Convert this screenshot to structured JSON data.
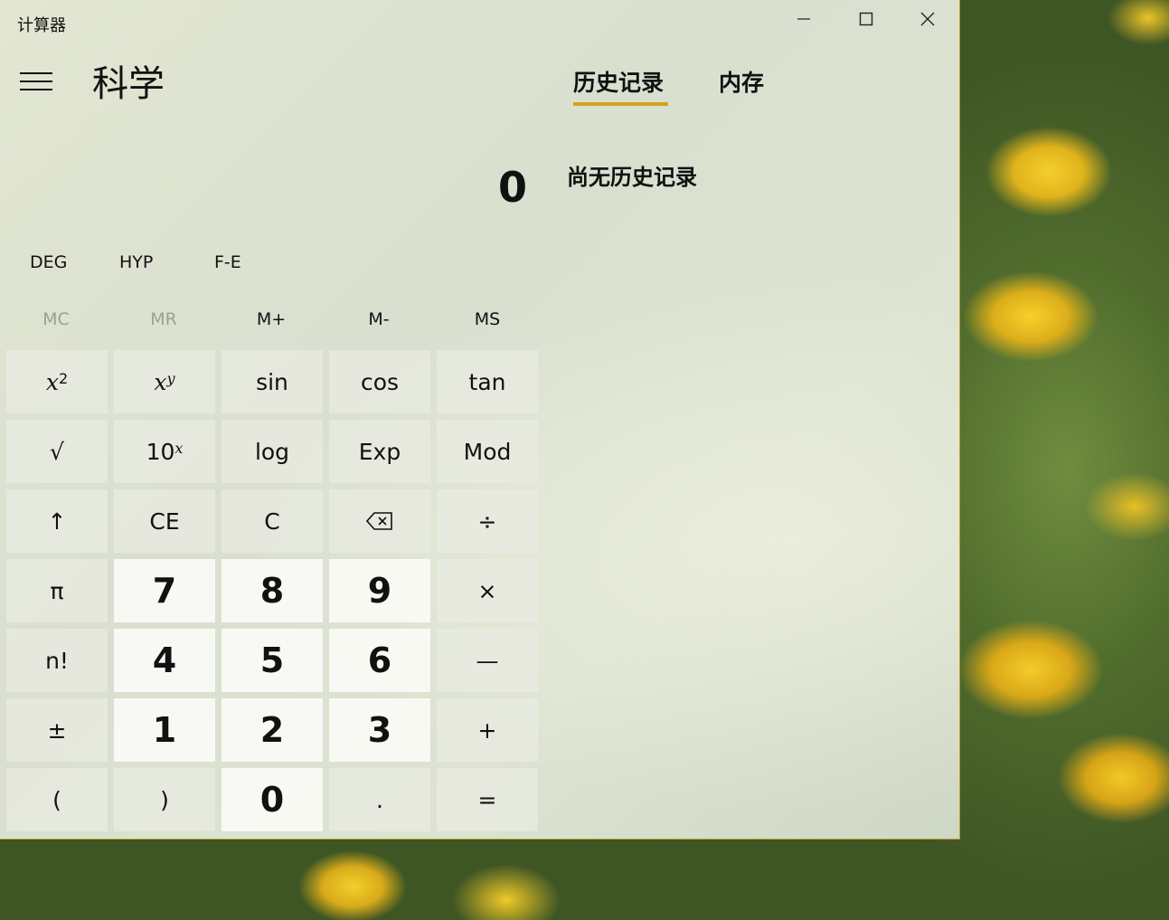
{
  "window": {
    "app_title": "计算器",
    "mode_title": "科学"
  },
  "tabs": {
    "history": "历史记录",
    "memory": "内存",
    "active": "history"
  },
  "history": {
    "empty_text": "尚无历史记录"
  },
  "display": {
    "value": "0"
  },
  "modes": {
    "angle": "DEG",
    "hyp": "HYP",
    "fe": "F-E"
  },
  "memory_buttons": [
    {
      "label": "MC",
      "enabled": false
    },
    {
      "label": "MR",
      "enabled": false
    },
    {
      "label": "M+",
      "enabled": true
    },
    {
      "label": "M-",
      "enabled": true
    },
    {
      "label": "MS",
      "enabled": true
    }
  ],
  "keys": {
    "x2_base": "x",
    "x2_exp": "2",
    "xy_base": "x",
    "xy_exp": "y",
    "sin": "sin",
    "cos": "cos",
    "tan": "tan",
    "sqrt": "√",
    "tenx_base": "10",
    "tenx_exp": "x",
    "log": "log",
    "exp": "Exp",
    "mod": "Mod",
    "shift": "↑",
    "ce": "CE",
    "c": "C",
    "backspace": "⌫",
    "divide": "÷",
    "pi": "π",
    "n7": "7",
    "n8": "8",
    "n9": "9",
    "multiply": "×",
    "fact": "n!",
    "n4": "4",
    "n5": "5",
    "n6": "6",
    "minus": "—",
    "negate": "±",
    "n1": "1",
    "n2": "2",
    "n3": "3",
    "plus": "+",
    "lparen": "(",
    "rparen": ")",
    "n0": "0",
    "dot": ".",
    "equals": "="
  },
  "colors": {
    "accent": "#d4a21a",
    "window_bg": "#dde3d2",
    "number_key_bg": "#fafaf6",
    "key_bg": "#ebece2",
    "disabled_text": "#9aa196"
  }
}
